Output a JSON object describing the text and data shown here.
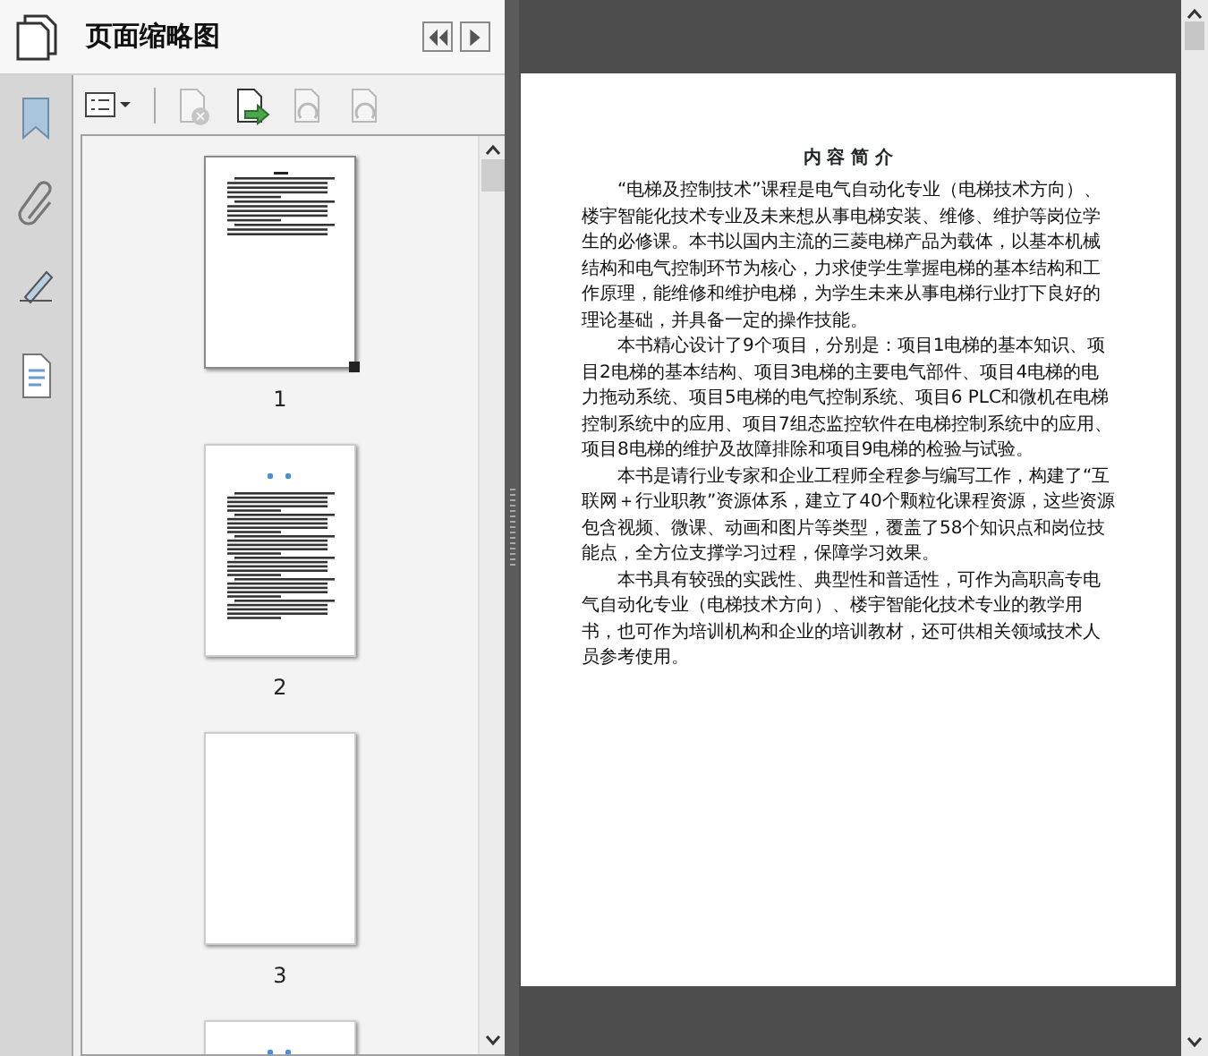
{
  "side_tools": [
    {
      "kind": "bookmark"
    },
    {
      "kind": "attachment"
    },
    {
      "kind": "signature"
    },
    {
      "kind": "content"
    }
  ],
  "panel": {
    "title": "页面缩略图",
    "header_buttons": [
      {
        "kind": "collapse"
      },
      {
        "kind": "next"
      }
    ],
    "toolbar": [
      {
        "kind": "options",
        "disabled": false
      },
      {
        "kind": "delete",
        "disabled": true
      },
      {
        "kind": "insert",
        "disabled": false
      },
      {
        "kind": "rotate-left",
        "disabled": true
      },
      {
        "kind": "rotate-right",
        "disabled": true
      }
    ],
    "thumbnails": [
      {
        "label": "1",
        "selected": true,
        "kind": "text"
      },
      {
        "label": "2",
        "selected": false,
        "kind": "dense"
      },
      {
        "label": "3",
        "selected": false,
        "kind": "blank"
      },
      {
        "kind": "dense",
        "selected": false
      }
    ]
  },
  "document": {
    "heading": "内 容 简 介",
    "paragraphs": [
      "“电梯及控制技术”课程是电气自动化专业（电梯技术方向）、楼宇智能化技术专业及未来想从事电梯安装、维修、维护等岗位学生的必修课。本书以国内主流的三菱电梯产品为载体，以基本机械结构和电气控制环节为核心，力求使学生掌握电梯的基本结构和工作原理，能维修和维护电梯，为学生未来从事电梯行业打下良好的理论基础，并具备一定的操作技能。",
      "本书精心设计了9个项目，分别是：项目1电梯的基本知识、项目2电梯的基本结构、项目3电梯的主要电气部件、项目4电梯的电力拖动系统、项目5电梯的电气控制系统、项目6 PLC和微机在电梯控制系统中的应用、项目7组态监控软件在电梯控制系统中的应用、项目8电梯的维护及故障排除和项目9电梯的检验与试验。",
      "本书是请行业专家和企业工程师全程参与编写工作，构建了“互联网＋行业职教”资源体系，建立了40个颗粒化课程资源，这些资源包含视频、微课、动画和图片等类型，覆盖了58个知识点和岗位技能点，全方位支撑学习过程，保障学习效果。",
      "本书具有较强的实践性、典型性和普适性，可作为高职高专电气自动化专业（电梯技术方向）、楼宇智能化技术专业的教学用书，也可作为培训机构和企业的培训教材，还可供相关领域技术人员参考使用。"
    ]
  }
}
